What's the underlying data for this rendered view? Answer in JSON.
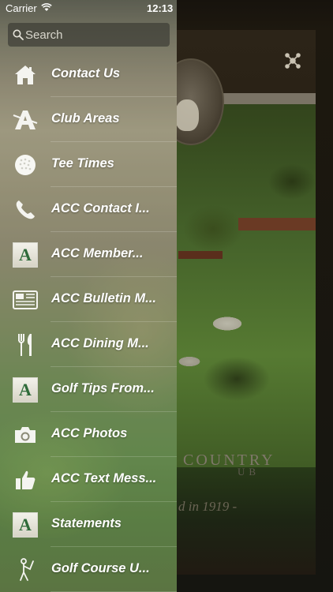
{
  "status_bar": {
    "carrier": "Carrier",
    "time": "12:13"
  },
  "search": {
    "placeholder": "Search",
    "value": ""
  },
  "menu": {
    "items": [
      {
        "label": "Contact Us",
        "icon": "house-icon"
      },
      {
        "label": "Club Areas",
        "icon": "club-areas-icon"
      },
      {
        "label": "Tee Times",
        "icon": "golf-ball-icon"
      },
      {
        "label": "ACC Contact I...",
        "icon": "phone-icon"
      },
      {
        "label": "ACC Member...",
        "icon": "acc-logo-icon"
      },
      {
        "label": "ACC Bulletin M...",
        "icon": "newspaper-icon"
      },
      {
        "label": "ACC Dining M...",
        "icon": "fork-knife-icon"
      },
      {
        "label": "Golf Tips From...",
        "icon": "acc-logo-icon"
      },
      {
        "label": "ACC Photos",
        "icon": "camera-icon"
      },
      {
        "label": "ACC Text Mess...",
        "icon": "thumbs-up-icon"
      },
      {
        "label": "Statements",
        "icon": "acc-logo-icon"
      },
      {
        "label": "Golf Course U...",
        "icon": "golfer-icon"
      }
    ]
  },
  "background": {
    "club_name_partial": "COUNTRY",
    "club_suffix_partial": "UB",
    "founded_partial": "d in 1919 -"
  },
  "logo_letter": "A",
  "colors": {
    "text": "#ffffff",
    "logo_green": "#2f6b3a"
  }
}
